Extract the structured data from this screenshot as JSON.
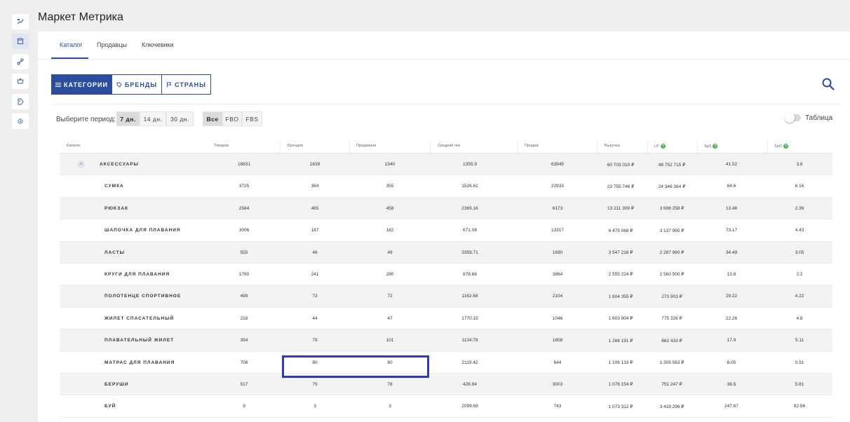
{
  "app": {
    "title": "Маркет Метрика"
  },
  "sidebar": {
    "icons": [
      "graph-icon",
      "store-icon",
      "link-icon",
      "basket-icon",
      "tag-icon",
      "gear-icon"
    ]
  },
  "tabs": [
    {
      "label": "Каталог",
      "active": true
    },
    {
      "label": "Продавцы",
      "active": false
    },
    {
      "label": "Ключевики",
      "active": false
    }
  ],
  "segments": [
    {
      "label": "КАТЕГОРИИ",
      "icon": "list-icon",
      "active": true
    },
    {
      "label": "БРЕНДЫ",
      "icon": "tag-icon",
      "active": false
    },
    {
      "label": "СТРАНЫ",
      "icon": "flag-icon",
      "active": false
    }
  ],
  "period": {
    "label": "Выберите период:",
    "options": [
      "7 дн.",
      "14 дн.",
      "30 дн."
    ],
    "selected": "7 дн."
  },
  "fulfillment": {
    "options": [
      "Все",
      "FBO",
      "FBS"
    ],
    "selected": "Все"
  },
  "toggle": {
    "label": "Таблица",
    "on": false
  },
  "table": {
    "columns": [
      "Каталог",
      "Товаров",
      "Брендов",
      "Продавцов",
      "Средний чек",
      "Продаж",
      "Выручка",
      "LP",
      "SpS",
      "SpO"
    ],
    "parent": {
      "name": "АКСЕССУАРЫ",
      "values": [
        "16831",
        "1639",
        "1540",
        "1355.9",
        "63945",
        "60 703 010 ₽",
        "48 752 715 ₽",
        "41.52",
        "3.8"
      ]
    },
    "rows": [
      {
        "name": "СУМКА",
        "values": [
          "3725",
          "364",
          "355",
          "1526.61",
          "22933",
          "23 755 746 ₽",
          "24 346 364 ₽",
          "64.6",
          "6.16"
        ]
      },
      {
        "name": "РЮКЗАК",
        "values": [
          "2584",
          "465",
          "458",
          "2369.16",
          "6173",
          "13 211 309 ₽",
          "3 698 258 ₽",
          "13.48",
          "2.39"
        ]
      },
      {
        "name": "ШАПОЧКА ДЛЯ ПЛАВАНИЯ",
        "values": [
          "3006",
          "187",
          "182",
          "671.08",
          "13317",
          "6 475 068 ₽",
          "3 137 965 ₽",
          "73.17",
          "4.43"
        ]
      },
      {
        "name": "ЛАСТЫ",
        "values": [
          "555",
          "48",
          "49",
          "3359.71",
          "1690",
          "3 547 216 ₽",
          "2 287 960 ₽",
          "34.49",
          "3.05"
        ]
      },
      {
        "name": "КРУГИ ДЛЯ ПЛАВАНИЯ",
        "values": [
          "1760",
          "241",
          "280",
          "878.66",
          "3864",
          "2 555 224 ₽",
          "1 560 500 ₽",
          "13.8",
          "2.2"
        ]
      },
      {
        "name": "ПОЛОТЕНЦЕ СПОРТИВНОЕ",
        "values": [
          "499",
          "73",
          "72",
          "1162.68",
          "2104",
          "1 604 355 ₽",
          "270 903 ₽",
          "29.22",
          "4.22"
        ]
      },
      {
        "name": "ЖИЛЕТ СПАСАТЕЛЬНЫЙ",
        "values": [
          "218",
          "44",
          "47",
          "1770.15",
          "1046",
          "1 603 904 ₽",
          "775 326 ₽",
          "22.26",
          "4.8"
        ]
      },
      {
        "name": "ПЛАВАТЕЛЬНЫЙ ЖИЛЕТ",
        "values": [
          "354",
          "79",
          "101",
          "1134.78",
          "1808",
          "1 266 191 ₽",
          "862 433 ₽",
          "17.9",
          "5.11"
        ]
      },
      {
        "name": "МАТРАС ДЛЯ ПЛАВАНИЯ",
        "values": [
          "708",
          "80",
          "80",
          "2119.42",
          "644",
          "1 106 133 ₽",
          "1 305 563 ₽",
          "8.05",
          "0.91"
        ]
      },
      {
        "name": "БЕРУШИ",
        "values": [
          "517",
          "75",
          "78",
          "426.84",
          "3003",
          "1 076 154 ₽",
          "751 247 ₽",
          "38.5",
          "5.81"
        ]
      },
      {
        "name": "БУЙ",
        "values": [
          "9",
          "3",
          "3",
          "2099.69",
          "743",
          "1 073 312 ₽",
          "3 418 296 ₽",
          "247.67",
          "82.56"
        ]
      }
    ]
  },
  "colors": {
    "accent": "#2c4c9c",
    "highlight": "#2f3bb0",
    "help": "#4caf50"
  }
}
